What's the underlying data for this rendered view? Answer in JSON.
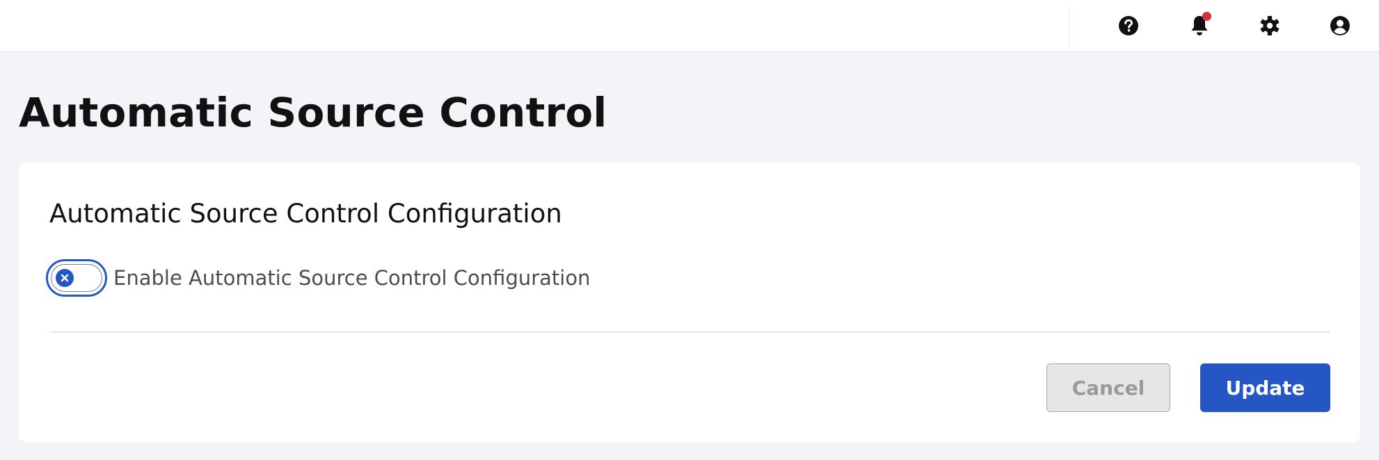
{
  "header": {
    "icons": {
      "help": "help-icon",
      "notifications": "bell-icon",
      "settings": "gear-icon",
      "account": "user-icon"
    },
    "notification_dot_color": "#d0313a"
  },
  "page": {
    "title": "Automatic Source Control"
  },
  "card": {
    "title": "Automatic Source Control Configuration",
    "toggle": {
      "label": "Enable Automatic Source Control Configuration",
      "enabled": false
    },
    "buttons": {
      "cancel_label": "Cancel",
      "update_label": "Update"
    }
  },
  "colors": {
    "accent": "#2457c5",
    "cancel_bg": "#e6e6e6",
    "page_bg": "#f3f4f8"
  }
}
